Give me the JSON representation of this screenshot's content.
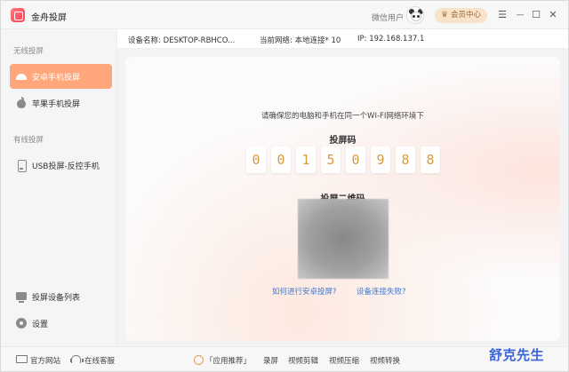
{
  "app": {
    "title": "金舟投屏"
  },
  "header": {
    "user_label": "微信用户",
    "member_label": "会员中心"
  },
  "window_controls": {
    "menu": "☰",
    "minimize": "—",
    "maximize": "☐",
    "close": "✕"
  },
  "sidebar": {
    "wireless_label": "无线投屏",
    "wired_label": "有线投屏",
    "items": [
      {
        "label": "安卓手机投屏",
        "icon": "android-icon",
        "active": true
      },
      {
        "label": "苹果手机投屏",
        "icon": "apple-icon",
        "active": false
      },
      {
        "label": "USB投屏-反控手机",
        "icon": "usb-icon",
        "active": false
      }
    ],
    "bottom_items": [
      {
        "label": "投屏设备列表",
        "icon": "devices-icon"
      },
      {
        "label": "设置",
        "icon": "gear-icon"
      }
    ]
  },
  "infobar": {
    "device_name": "设备名称: DESKTOP-RBHCO...",
    "network": "当前网络:  本地连接* 10",
    "ip": "IP: 192.168.137.1"
  },
  "main": {
    "hint": "请确保您的电脑和手机在同一个WI-FI网络环境下",
    "code_title": "投屏码",
    "code_digits": [
      "0",
      "0",
      "1",
      "5",
      "0",
      "9",
      "8",
      "8"
    ],
    "qr_title": "投屏二维码",
    "link_howto": "如何进行安卓投屏?",
    "link_fail": "设备连接失败?"
  },
  "footer": {
    "website": "官方网站",
    "support": "在线客服",
    "apps": "「应用推荐」",
    "record": "录屏",
    "video_edit": "视频剪辑",
    "video_compress": "视频压缩",
    "video_convert": "视频转换"
  },
  "watermark": "舒克先生",
  "colors": {
    "accent": "#ffa67a",
    "digit": "#d89a3a",
    "link": "#3a7ad9",
    "watermark": "#3c63d6"
  }
}
